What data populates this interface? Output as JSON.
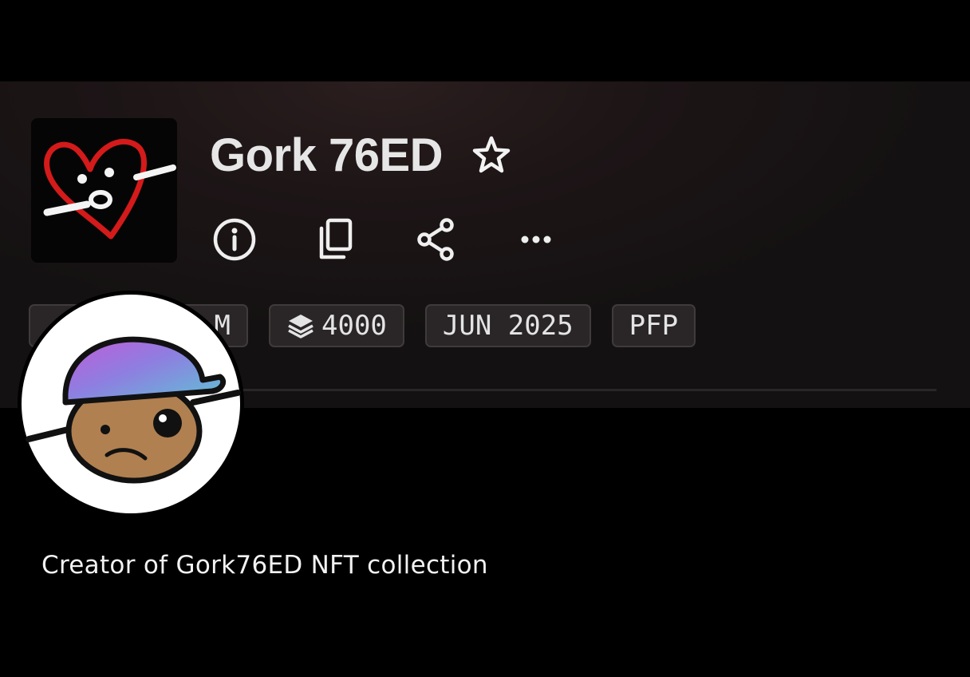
{
  "collection": {
    "name": "Gork 76ED",
    "logo_icon": "heart-face-logo-icon"
  },
  "actions": [
    {
      "name": "info-icon"
    },
    {
      "name": "copy-icon"
    },
    {
      "name": "share-icon"
    },
    {
      "name": "more-options-icon"
    }
  ],
  "tags": {
    "first_visible": "M",
    "items_count": "4000",
    "date": "JUN 2025",
    "category": "PFP"
  },
  "profile": {
    "avatar_icon": "cap-character-avatar",
    "bio": "Creator of Gork76ED NFT collection"
  },
  "colors": {
    "background": "#000000",
    "banner": "#1d1516",
    "tag_bg": "#2a2627",
    "text": "#e6e6e6"
  }
}
